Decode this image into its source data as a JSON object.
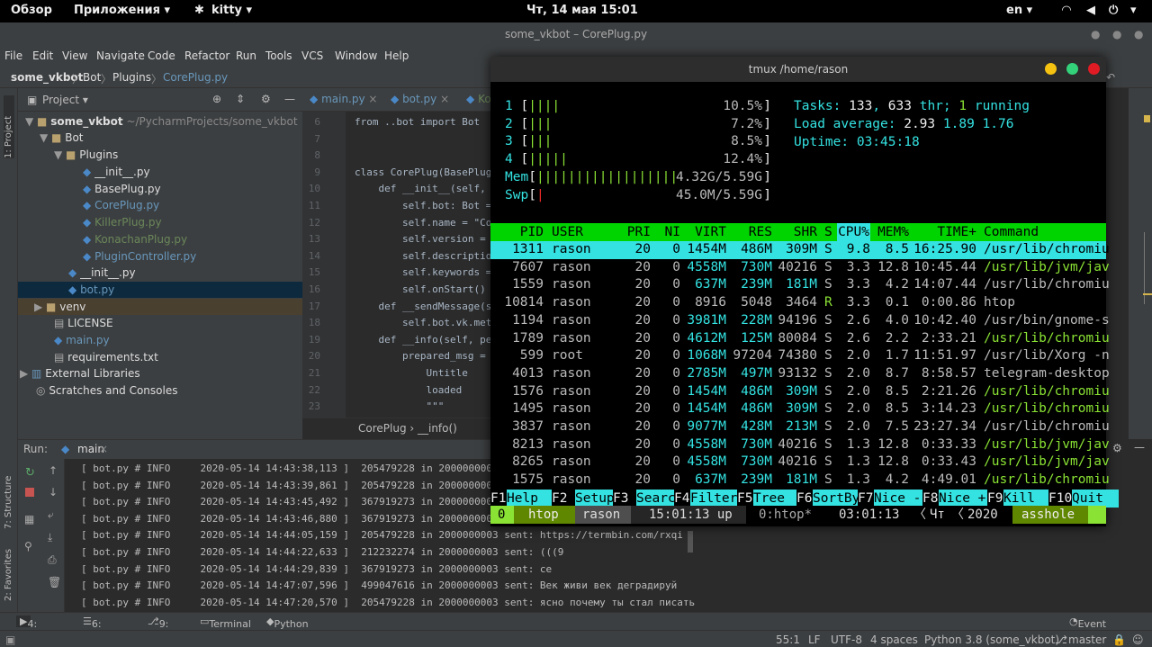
{
  "topbar": {
    "overview": "Обзор",
    "apps": "Приложения ▾",
    "app": "kitty ▾",
    "clock": "Чт, 14 мая  15:01",
    "lang": "en ▾"
  },
  "ide": {
    "title": "some_vkbot – CorePlug.py",
    "menu": [
      "File",
      "Edit",
      "View",
      "Navigate",
      "Code",
      "Refactor",
      "Run",
      "Tools",
      "VCS",
      "Window",
      "Help"
    ],
    "breadcrumb": [
      "some_vkbot",
      "Bot",
      "Plugins",
      "CorePlug.py"
    ],
    "project_label": "Project ▾",
    "tree": [
      {
        "label": "some_vkbot",
        "extra": "~/PycharmProjects/some_vkbot",
        "indent": 0,
        "arrow": "▼",
        "color": "#ddd",
        "bold": true
      },
      {
        "label": "Bot",
        "indent": 1,
        "arrow": "▼",
        "color": "#ddd"
      },
      {
        "label": "Plugins",
        "indent": 2,
        "arrow": "▼",
        "color": "#ddd"
      },
      {
        "label": "__init__.py",
        "indent": 4,
        "color": "#ddd"
      },
      {
        "label": "BasePlug.py",
        "indent": 4,
        "color": "#ddd"
      },
      {
        "label": "CorePlug.py",
        "indent": 4,
        "color": "#6897bb"
      },
      {
        "label": "KillerPlug.py",
        "indent": 4,
        "color": "#6a8759"
      },
      {
        "label": "KonachanPlug.py",
        "indent": 4,
        "color": "#6a8759"
      },
      {
        "label": "PluginController.py",
        "indent": 4,
        "color": "#6897bb"
      },
      {
        "label": "__init__.py",
        "indent": 3,
        "color": "#ddd"
      },
      {
        "label": "bot.py",
        "indent": 3,
        "color": "#6897bb",
        "selected": true
      },
      {
        "label": "venv",
        "indent": 1,
        "arrow": "▶",
        "color": "#ddd",
        "venv": true
      },
      {
        "label": "LICENSE",
        "indent": 2,
        "color": "#ddd"
      },
      {
        "label": "main.py",
        "indent": 2,
        "color": "#6897bb"
      },
      {
        "label": "requirements.txt",
        "indent": 2,
        "color": "#ddd"
      },
      {
        "label": "External Libraries",
        "indent": 0,
        "arrow": "▶",
        "color": "#ddd"
      },
      {
        "label": "Scratches and Consoles",
        "indent": 1,
        "color": "#ddd"
      }
    ],
    "tabs": [
      "main.py",
      "bot.py",
      "Ko"
    ],
    "lines": [
      "6",
      "7",
      "8",
      "9",
      "10",
      "11",
      "12",
      "13",
      "14",
      "15",
      "16",
      "17",
      "18",
      "19",
      "20",
      "21",
      "22",
      "23"
    ],
    "code": [
      "from ..bot import Bot",
      "",
      "",
      "class CorePlug(BasePlug",
      "    def __init__(self,",
      "        self.bot: Bot =",
      "        self.name = \"Co",
      "        self.version =",
      "        self.descriptio",
      "        self.keywords =",
      "        self.onStart()",
      "    def __sendMessage(s",
      "        self.bot.vk.met",
      "    def __info(self, pe",
      "        prepared_msg =",
      "            Untitle",
      "            loaded",
      "            \"\"\""
    ],
    "code_crumb": "CorePlug  ›  __info()",
    "run_label": "Run:",
    "run_tab": "main",
    "console": [
      "[ bot.py # INFO     2020-05-14 14:43:38,113 ]  205479228 in 2000000003",
      "[ bot.py # INFO     2020-05-14 14:43:39,861 ]  205479228 in 2000000003",
      "[ bot.py # INFO     2020-05-14 14:43:45,492 ]  367919273 in 2000000003",
      "[ bot.py # INFO     2020-05-14 14:43:46,880 ]  367919273 in 2000000003 sent: на термбин",
      "[ bot.py # INFO     2020-05-14 14:44:05,159 ]  205479228 in 2000000003 sent: https://termbin.com/rxqi",
      "[ bot.py # INFO     2020-05-14 14:44:22,633 ]  212232274 in 2000000003 sent: (((9",
      "[ bot.py # INFO     2020-05-14 14:44:29,839 ]  367919273 in 2000000003 sent: се",
      "[ bot.py # INFO     2020-05-14 14:47:07,596 ]  499047616 in 2000000003 sent: Век живи век деградируй",
      "[ bot.py # INFO     2020-05-14 14:47:20,570 ]  205479228 in 2000000003 sent: ясно почему ты стал писать"
    ],
    "tooltabs": [
      "4: Run",
      "6: TODO",
      "9: Git",
      "Terminal",
      "Python Console",
      "Event Log"
    ],
    "status": {
      "pos": "55:1",
      "le": "LF",
      "enc": "UTF-8",
      "indent": "4 spaces",
      "interp": "Python 3.8 (some_vkbot)",
      "branch": "master"
    },
    "side_labels": [
      "1: Project",
      "7: Structure",
      "2: Favorites"
    ]
  },
  "tmux": {
    "title": "tmux /home/rason",
    "meters": [
      {
        "label": "1",
        "bars": "||||",
        "value": "10.5%"
      },
      {
        "label": "2",
        "bars": "|||",
        "value": "7.2%"
      },
      {
        "label": "3",
        "bars": "|||",
        "value": "8.5%"
      },
      {
        "label": "4",
        "bars": "|||||",
        "value": "12.4%"
      }
    ],
    "mem": {
      "label": "Mem",
      "bars": "||||||||||||||||||",
      "used": "4.32G",
      "total": "5.59G"
    },
    "swp": {
      "label": "Swp",
      "bars": "|",
      "value": "45.0M/5.59G"
    },
    "tasks": {
      "label": "Tasks: ",
      "tasks": "133",
      "thr": "633",
      "running": "1"
    },
    "load": {
      "label": "Load average: ",
      "a": "2.93",
      "b": "1.89",
      "c": "1.76"
    },
    "uptime": {
      "label": "Uptime: ",
      "value": "03:45:18"
    },
    "header": [
      "PID",
      "USER",
      "PRI",
      "NI",
      "VIRT",
      "RES",
      "SHR",
      "S",
      "CPU%",
      "MEM%",
      "TIME+",
      "Command"
    ],
    "procs": [
      [
        "1311",
        "rason",
        "20",
        "0",
        "1454M",
        "486M",
        "309M",
        "S",
        "9.8",
        "8.5",
        "16:25.90",
        "/usr/lib/chromiu"
      ],
      [
        "7607",
        "rason",
        "20",
        "0",
        "4558M",
        "730M",
        "40216",
        "S",
        "3.3",
        "12.8",
        "10:45.44",
        "/usr/lib/jvm/jav"
      ],
      [
        "1559",
        "rason",
        "20",
        "0",
        "637M",
        "239M",
        "181M",
        "S",
        "3.3",
        "4.2",
        "14:07.44",
        "/usr/lib/chromiu"
      ],
      [
        "10814",
        "rason",
        "20",
        "0",
        "8916",
        "5048",
        "3464",
        "R",
        "3.3",
        "0.1",
        "0:00.86",
        "htop"
      ],
      [
        "1194",
        "rason",
        "20",
        "0",
        "3981M",
        "228M",
        "94196",
        "S",
        "2.6",
        "4.0",
        "10:42.40",
        "/usr/bin/gnome-s"
      ],
      [
        "1789",
        "rason",
        "20",
        "0",
        "4612M",
        "125M",
        "80084",
        "S",
        "2.6",
        "2.2",
        "2:33.21",
        "/usr/lib/chromiu"
      ],
      [
        "599",
        "root",
        "20",
        "0",
        "1068M",
        "97204",
        "74380",
        "S",
        "2.0",
        "1.7",
        "11:51.97",
        "/usr/lib/Xorg -n"
      ],
      [
        "4013",
        "rason",
        "20",
        "0",
        "2785M",
        "497M",
        "93132",
        "S",
        "2.0",
        "8.7",
        "8:58.57",
        "telegram-desktop"
      ],
      [
        "1576",
        "rason",
        "20",
        "0",
        "1454M",
        "486M",
        "309M",
        "S",
        "2.0",
        "8.5",
        "2:21.26",
        "/usr/lib/chromiu"
      ],
      [
        "1495",
        "rason",
        "20",
        "0",
        "1454M",
        "486M",
        "309M",
        "S",
        "2.0",
        "8.5",
        "3:14.23",
        "/usr/lib/chromiu"
      ],
      [
        "3837",
        "rason",
        "20",
        "0",
        "9077M",
        "428M",
        "213M",
        "S",
        "2.0",
        "7.5",
        "23:27.34",
        "/usr/lib/chromiu"
      ],
      [
        "8213",
        "rason",
        "20",
        "0",
        "4558M",
        "730M",
        "40216",
        "S",
        "1.3",
        "12.8",
        "0:33.33",
        "/usr/lib/jvm/jav"
      ],
      [
        "8265",
        "rason",
        "20",
        "0",
        "4558M",
        "730M",
        "40216",
        "S",
        "1.3",
        "12.8",
        "0:33.43",
        "/usr/lib/jvm/jav"
      ],
      [
        "1575",
        "rason",
        "20",
        "0",
        "637M",
        "239M",
        "181M",
        "S",
        "1.3",
        "4.2",
        "4:49.01",
        "/usr/lib/chromiu"
      ]
    ],
    "fkeys": [
      [
        "F1",
        "Help"
      ],
      [
        "F2",
        "Setup"
      ],
      [
        "F3",
        "Search"
      ],
      [
        "F4",
        "Filter"
      ],
      [
        "F5",
        "Tree"
      ],
      [
        "F6",
        "SortBy"
      ],
      [
        "F7",
        "Nice -"
      ],
      [
        "F8",
        "Nice +"
      ],
      [
        "F9",
        "Kill"
      ],
      [
        "F10",
        "Quit"
      ]
    ],
    "status": {
      "win": "0",
      "app": "htop",
      "user": "rason",
      "time": "15:01:13 up",
      "pane": "0:htop*",
      "clock": "03:01:13",
      "day": "Чт",
      "year": "2020",
      "host": "asshole"
    }
  }
}
